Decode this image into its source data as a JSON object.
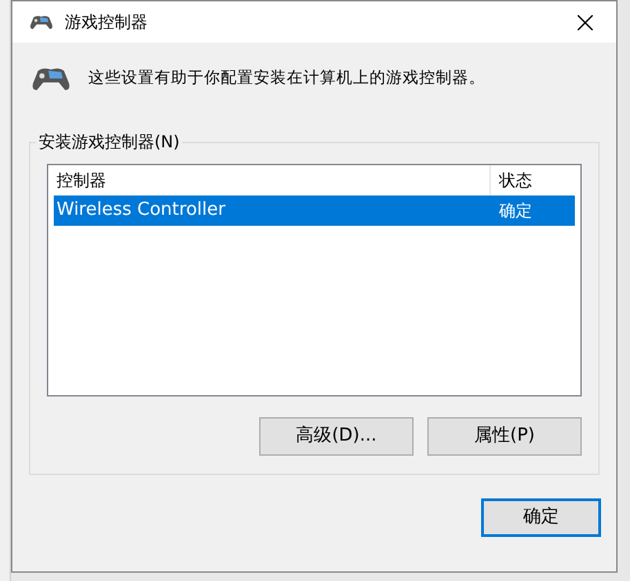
{
  "window": {
    "title": "游戏控制器"
  },
  "description": "这些设置有助于你配置安装在计算机上的游戏控制器。",
  "group": {
    "label": "安装游戏控制器(N)"
  },
  "table": {
    "columns": [
      "控制器",
      "状态"
    ],
    "rows": [
      {
        "cells": [
          "Wireless Controller",
          "确定"
        ],
        "selected": true
      }
    ]
  },
  "buttons": [
    {
      "label": "高级(D)...",
      "default": false
    },
    {
      "label": "属性(P)",
      "default": false
    }
  ],
  "footer_buttons": [
    {
      "label": "确定",
      "default": true
    }
  ]
}
